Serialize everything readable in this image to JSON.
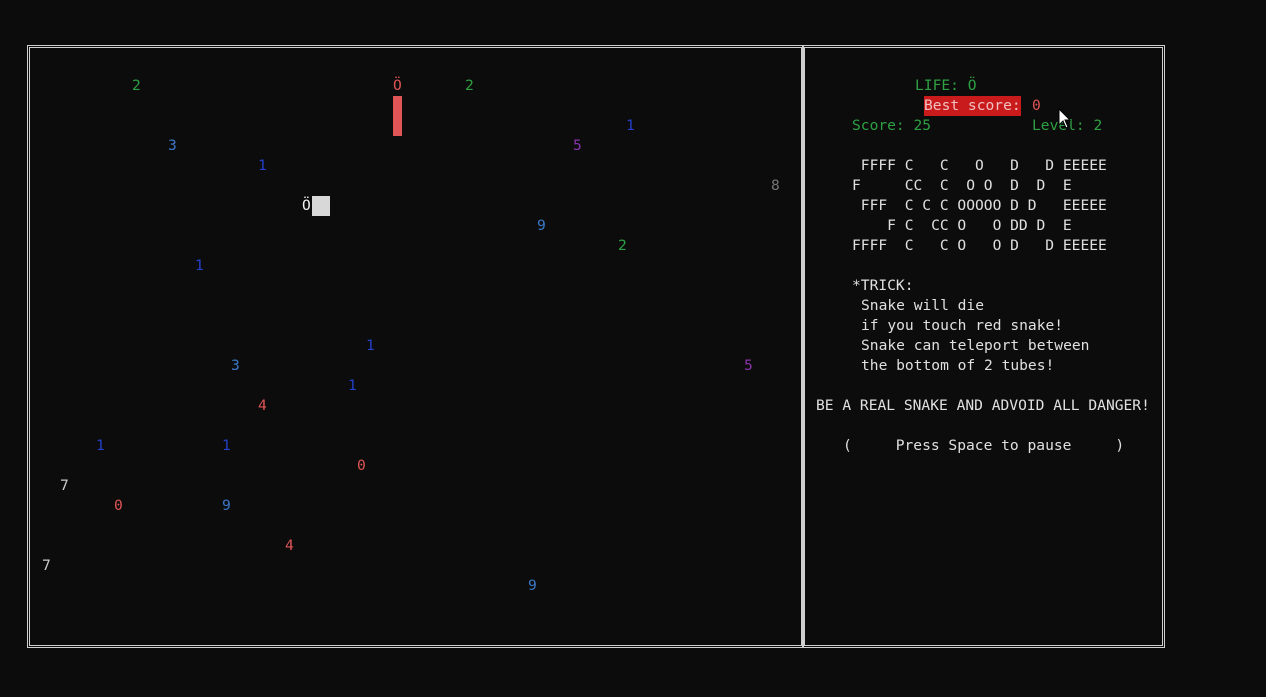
{
  "game": {
    "playfield": {
      "numbers": [
        {
          "text": "2",
          "color": "#2ea043"
        },
        {
          "text": "2",
          "color": "#2ea043"
        },
        {
          "text": "1",
          "color": "#2540c8"
        },
        {
          "text": "3",
          "color": "#3b78c8"
        },
        {
          "text": "5",
          "color": "#8a35a8"
        },
        {
          "text": "1",
          "color": "#2540c8"
        },
        {
          "text": "8",
          "color": "#767676"
        },
        {
          "text": "9",
          "color": "#3b78c8"
        },
        {
          "text": "2",
          "color": "#2ea043"
        },
        {
          "text": "1",
          "color": "#2540c8"
        },
        {
          "text": "1",
          "color": "#2540c8"
        },
        {
          "text": "3",
          "color": "#3b78c8"
        },
        {
          "text": "5",
          "color": "#8a35a8"
        },
        {
          "text": "1",
          "color": "#2540c8"
        },
        {
          "text": "4",
          "color": "#e05555"
        },
        {
          "text": "1",
          "color": "#2540c8"
        },
        {
          "text": "1",
          "color": "#2540c8"
        },
        {
          "text": "0",
          "color": "#e05555"
        },
        {
          "text": "7",
          "color": "#cccccc"
        },
        {
          "text": "0",
          "color": "#e05555"
        },
        {
          "text": "9",
          "color": "#3b78c8"
        },
        {
          "text": "4",
          "color": "#e05555"
        },
        {
          "text": "7",
          "color": "#cccccc"
        },
        {
          "text": "9",
          "color": "#3b78c8"
        }
      ],
      "enemy_snake_head": "Ö",
      "player_snake_head": "Ö"
    },
    "panel": {
      "life_label": "LIFE: Ö",
      "best_score_label": "Best score:",
      "best_score_value": "0",
      "score_label": "Score: 25",
      "level_label": "Level: 2",
      "banner": [
        " FFFF C   C   O   D   D EEEEE",
        "F     CC  C  O O  D  D  E",
        " FFF  C C C OOOOO D D   EEEEE",
        "    F C  CC O   O DD D  E",
        "FFFF  C   C O   O D   D EEEEE"
      ],
      "trick_title": "*TRICK:",
      "trick_lines": [
        "Snake will die",
        "if you touch red snake!",
        "Snake can teleport between",
        "the bottom of 2 tubes!"
      ],
      "warning": "BE A REAL SNAKE AND ADVOID ALL DANGER!",
      "pause_hint": "(     Press Space to pause     )"
    }
  }
}
